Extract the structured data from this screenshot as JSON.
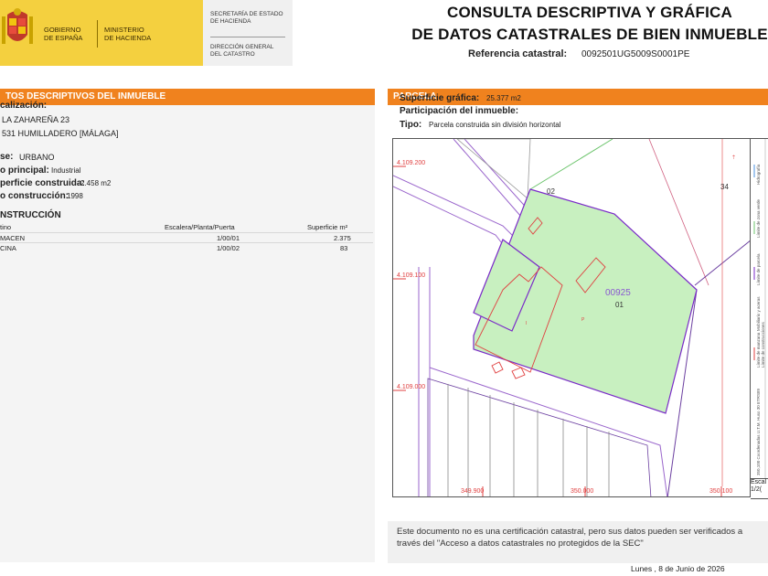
{
  "header": {
    "gobierno": "GOBIERNO\nDE ESPAÑA",
    "ministerio": "MINISTERIO\nDE HACIENDA",
    "secretaria": "SECRETARÍA DE ESTADO\nDE HACIENDA",
    "direccion": "DIRECCIÓN GENERAL\nDEL CATASTRO",
    "title_line1": "CONSULTA DESCRIPTIVA Y GRÁFICA",
    "title_line2": "DE DATOS CATASTRALES DE BIEN INMUEBLE",
    "ref_label": "Referencia catastral:",
    "ref_value": "0092501UG5009S0001PE"
  },
  "left": {
    "heading": "TOS DESCRIPTIVOS DEL INMUEBLE",
    "localizacion_label": "calización:",
    "address_line1": "LA ZAHAREÑA 23",
    "address_line2": "531 HUMILLADERO [MÁLAGA]",
    "clase_label": "se:",
    "clase_value": "URBANO",
    "uso_label": "o principal:",
    "uso_value": "Industrial",
    "superficie_label": "perficie construida:",
    "superficie_value": "2.458 m2",
    "anio_label": "o construcción:",
    "anio_value": "1998",
    "construccion_heading": "NSTRUCCIÓN",
    "table": {
      "headers": [
        "tino",
        "Escalera/Planta/Puerta",
        "Superficie m²"
      ],
      "rows": [
        [
          "MACEN",
          "1/00/01",
          "2.375"
        ],
        [
          "CINA",
          "1/00/02",
          "83"
        ]
      ]
    }
  },
  "right": {
    "heading": "PARCELA",
    "superficie_grafica_label": "Superficie gráfica:",
    "superficie_grafica_value": "25.377 m2",
    "participacion_label": "Participación del inmueble:",
    "tipo_label": "Tipo:",
    "tipo_value": "Parcela construida sin división horizontal"
  },
  "map": {
    "parcel_ref": "00925",
    "parcel_num": "01",
    "neighbor_02": "02",
    "neighbor_34": "34",
    "coord_y1": "4.109.200",
    "coord_y2": "4.109.100",
    "coord_y3": "4.109.000",
    "coord_x1": "349.900",
    "coord_x2": "350.000",
    "coord_x3": "350.100",
    "parcel_fill": "#c8f0c0",
    "parcel_stroke": "#7a2ac8",
    "building_stroke": "#e04040",
    "legend_items": [
      "Hidrografía",
      "Límite de zona verde",
      "Límite de parcela",
      "Mobiliario y aceras",
      "Límite de manzana",
      "Límite de construcciones"
    ],
    "coord_note": "350,100 Coordenadas U.T.M. Huso 30 ETRS89",
    "scale_label": "Escal",
    "scale_value": "1/2("
  },
  "footer": {
    "disclaimer": "Este documento no es una certificación catastral, pero sus datos pueden ser verificados a través del \"Acceso a datos catastrales no protegidos de la SEC\"",
    "date": "Lunes , 8 de Junio de 2026"
  }
}
